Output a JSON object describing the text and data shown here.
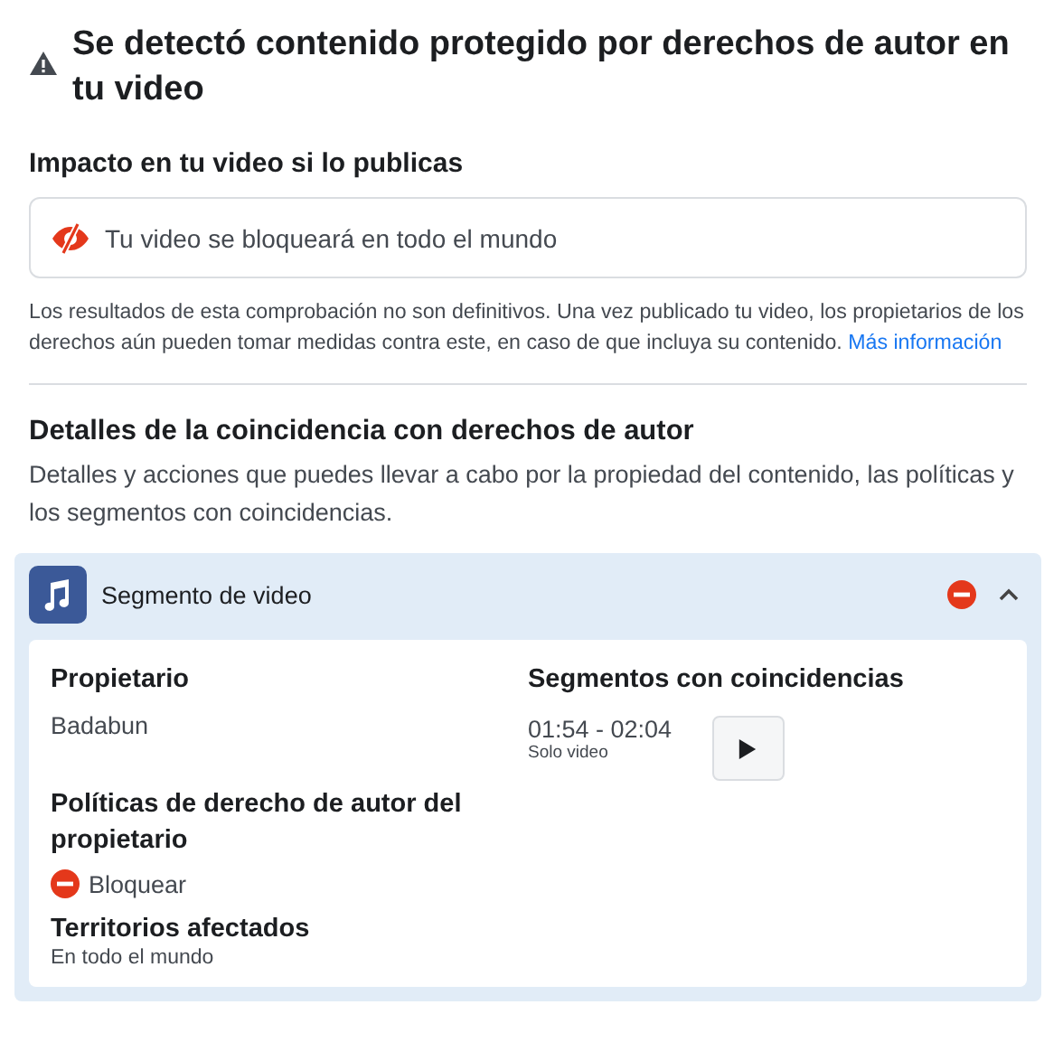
{
  "header": {
    "title": "Se detectó contenido protegido por derechos de autor en tu video"
  },
  "impact": {
    "heading": "Impacto en tu video si lo publicas",
    "message": "Tu video se bloqueará en todo el mundo",
    "note": "Los resultados de esta comprobación no son definitivos. Una vez publicado tu video, los propietarios de los derechos aún pueden tomar medidas contra este, en caso de que incluya su contenido.",
    "link": "Más información"
  },
  "details": {
    "heading": "Detalles de la coincidencia con derechos de autor",
    "description": "Detalles y acciones que puedes llevar a cabo por la propiedad del contenido, las políticas y los segmentos con coincidencias."
  },
  "match": {
    "title": "Segmento de video",
    "expanded": true,
    "owner_label": "Propietario",
    "owner": "Badabun",
    "policies_label": "Políticas de derecho de autor del propietario",
    "policy": "Bloquear",
    "territories_label": "Territorios afectados",
    "territories": "En todo el mundo",
    "segments_label": "Segmentos con coincidencias",
    "segments": [
      {
        "range": "01:54 - 02:04",
        "type": "Solo video"
      }
    ]
  }
}
